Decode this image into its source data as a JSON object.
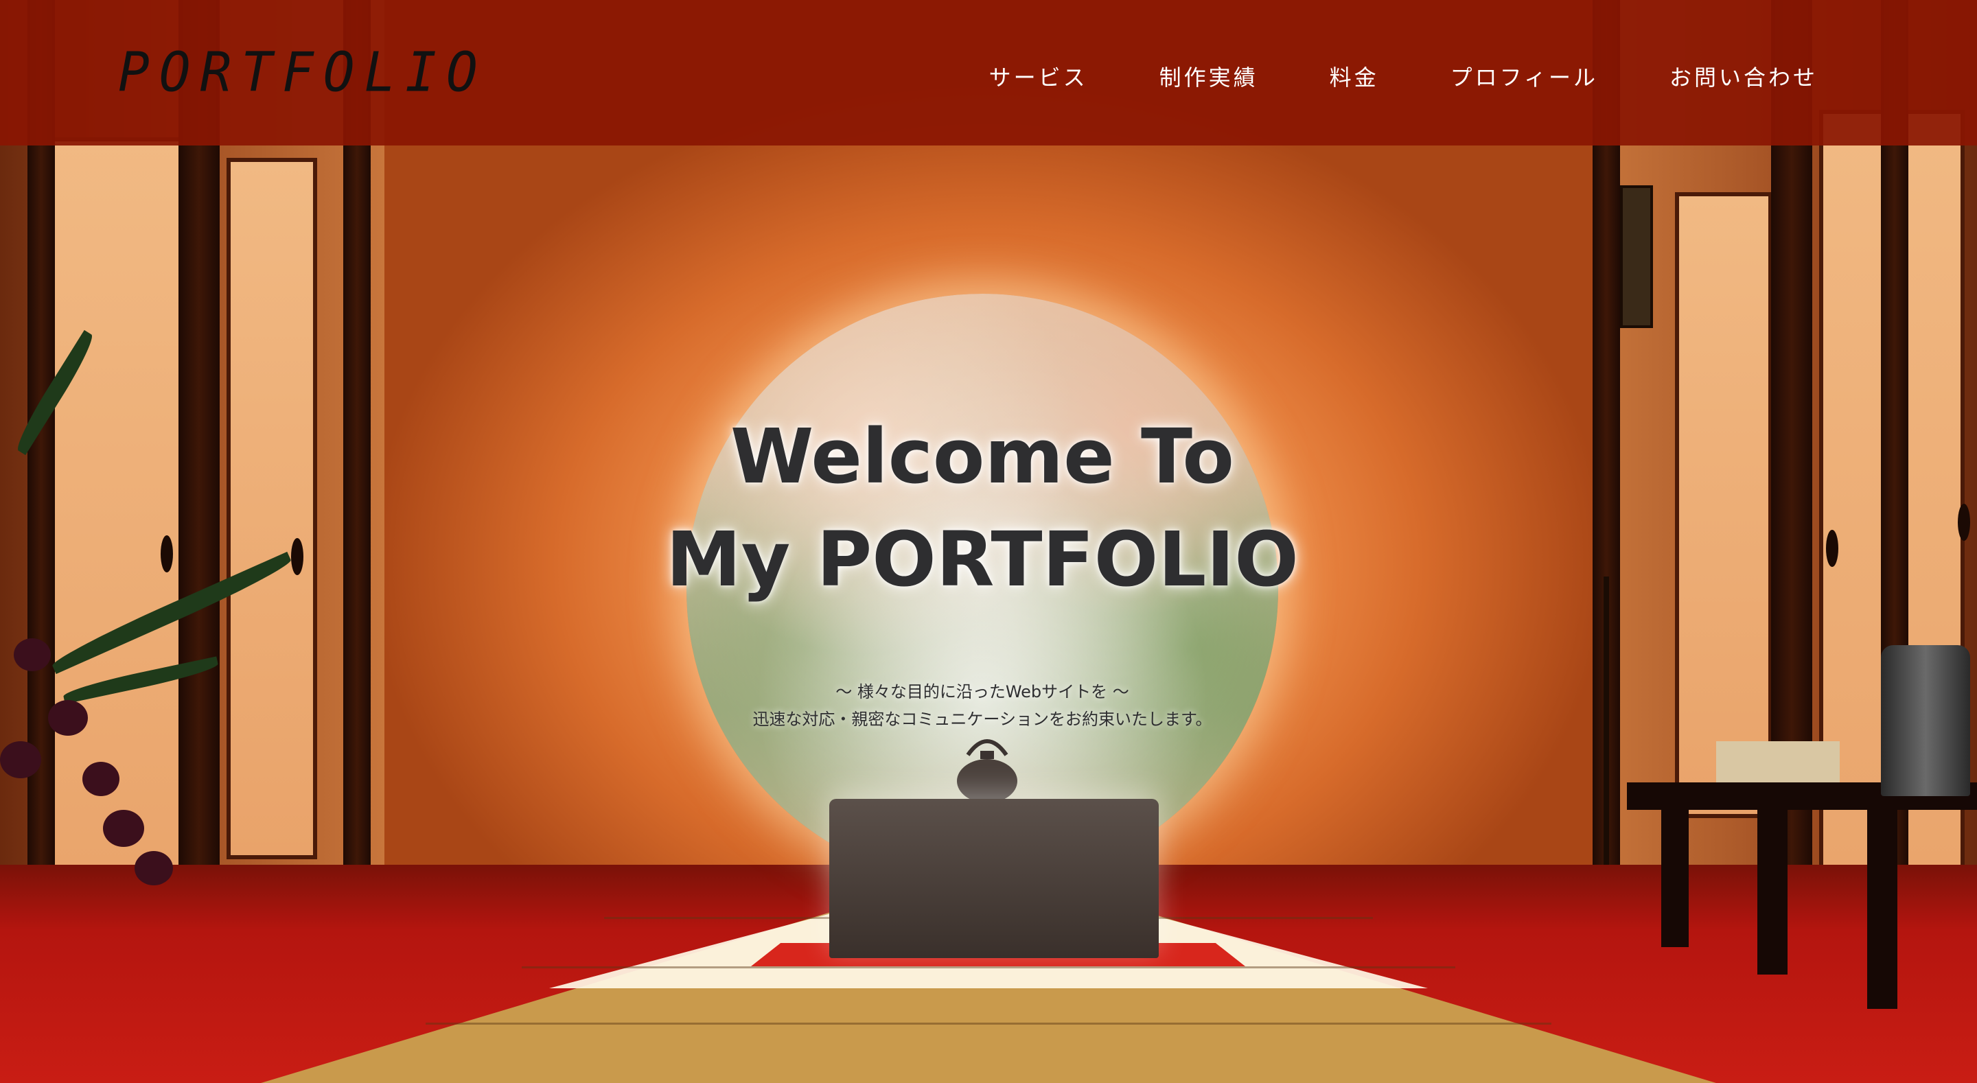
{
  "header": {
    "logo": "PORTFOLIO",
    "nav": [
      {
        "label": "サービス"
      },
      {
        "label": "制作実績"
      },
      {
        "label": "料金"
      },
      {
        "label": "プロフィール"
      },
      {
        "label": "お問い合わせ"
      }
    ]
  },
  "hero": {
    "title_line1": "Welcome To",
    "title_line2": "My PORTFOLIO",
    "subtitle_line1": "〜 様々な目的に沿ったWebサイトを 〜",
    "subtitle_line2": "迅速な対応・親密なコミュニケーションをお約束いたします。"
  },
  "colors": {
    "header_bg": "#8a1602",
    "wall": "#ef8e4a",
    "floor_red": "#c91d14",
    "title_text": "#2e2e30",
    "nav_text": "#ffffff"
  }
}
